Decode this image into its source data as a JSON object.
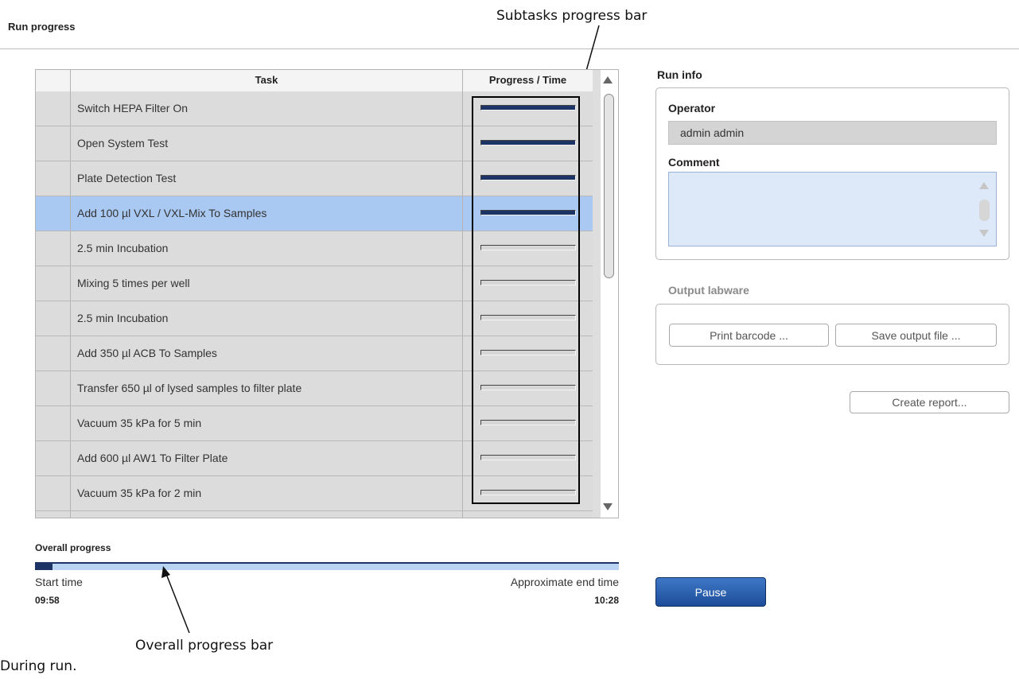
{
  "header": {
    "title": "Run progress"
  },
  "grid": {
    "columns": [
      "",
      "Task",
      "Progress / Time"
    ],
    "rows": [
      {
        "task": "Switch HEPA Filter On",
        "progress": 1.0,
        "selected": false
      },
      {
        "task": "Open System Test",
        "progress": 1.0,
        "selected": false
      },
      {
        "task": "Plate Detection Test",
        "progress": 1.0,
        "selected": false
      },
      {
        "task": "Add 100 µl VXL / VXL-Mix To Samples",
        "progress": 0.98,
        "selected": true
      },
      {
        "task": "2.5 min Incubation",
        "progress": 0.0,
        "selected": false
      },
      {
        "task": "Mixing 5 times per well",
        "progress": 0.0,
        "selected": false
      },
      {
        "task": "2.5 min Incubation",
        "progress": 0.0,
        "selected": false
      },
      {
        "task": "Add 350 µl ACB To Samples",
        "progress": 0.0,
        "selected": false
      },
      {
        "task": "Transfer 650 µl of lysed samples to filter plate",
        "progress": 0.0,
        "selected": false
      },
      {
        "task": "Vacuum 35 kPa for 5 min",
        "progress": 0.0,
        "selected": false
      },
      {
        "task": "Add 600 µl AW1 To Filter Plate",
        "progress": 0.0,
        "selected": false
      },
      {
        "task": "Vacuum 35 kPa for 2 min",
        "progress": 0.0,
        "selected": false
      }
    ]
  },
  "overall": {
    "label": "Overall progress",
    "progress": 0.03,
    "start_label": "Start time",
    "start_value": "09:58",
    "end_label": "Approximate end time",
    "end_value": "10:28"
  },
  "run_info": {
    "title": "Run info",
    "operator_label": "Operator",
    "operator_value": "admin admin",
    "comment_label": "Comment",
    "comment_value": ""
  },
  "output_labware": {
    "title": "Output labware",
    "print_barcode": "Print barcode ...",
    "save_output": "Save output file ..."
  },
  "buttons": {
    "create_report": "Create report...",
    "pause": "Pause"
  },
  "annotations": {
    "subtasks": "Subtasks progress bar",
    "overall": "Overall progress bar",
    "caption": "During run."
  },
  "colors": {
    "progress_fill": "#1c3566",
    "selected_row": "#a9c8f2",
    "overall_track": "#b9d3f3",
    "pause_button": "#2a5fae"
  }
}
